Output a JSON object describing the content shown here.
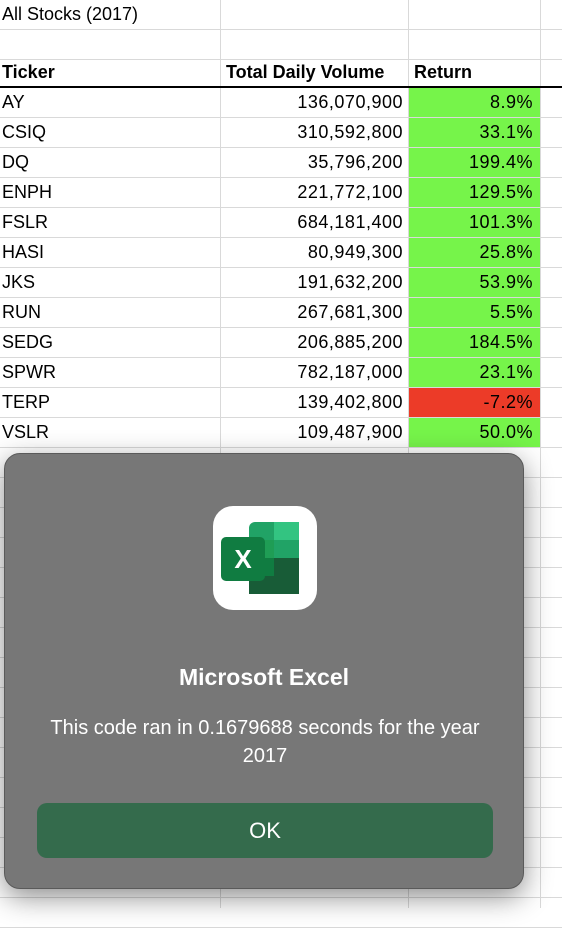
{
  "sheet": {
    "title": "All Stocks (2017)",
    "headers": [
      "Ticker",
      "Total Daily Volume",
      "Return"
    ],
    "rows": [
      {
        "ticker": "AY",
        "volume": "136,070,900",
        "ret": "8.9%",
        "status": "positive"
      },
      {
        "ticker": "CSIQ",
        "volume": "310,592,800",
        "ret": "33.1%",
        "status": "positive"
      },
      {
        "ticker": "DQ",
        "volume": "35,796,200",
        "ret": "199.4%",
        "status": "positive"
      },
      {
        "ticker": "ENPH",
        "volume": "221,772,100",
        "ret": "129.5%",
        "status": "positive"
      },
      {
        "ticker": "FSLR",
        "volume": "684,181,400",
        "ret": "101.3%",
        "status": "positive"
      },
      {
        "ticker": "HASI",
        "volume": "80,949,300",
        "ret": "25.8%",
        "status": "positive"
      },
      {
        "ticker": "JKS",
        "volume": "191,632,200",
        "ret": "53.9%",
        "status": "positive"
      },
      {
        "ticker": "RUN",
        "volume": "267,681,300",
        "ret": "5.5%",
        "status": "positive"
      },
      {
        "ticker": "SEDG",
        "volume": "206,885,200",
        "ret": "184.5%",
        "status": "positive"
      },
      {
        "ticker": "SPWR",
        "volume": "782,187,000",
        "ret": "23.1%",
        "status": "positive"
      },
      {
        "ticker": "TERP",
        "volume": "139,402,800",
        "ret": "-7.2%",
        "status": "negative"
      },
      {
        "ticker": "VSLR",
        "volume": "109,487,900",
        "ret": "50.0%",
        "status": "positive"
      }
    ]
  },
  "colors": {
    "positive": "#76f44a",
    "negative": "#ec3b28",
    "ok_button": "#346b4c"
  },
  "dialog": {
    "icon": "excel-app-icon",
    "icon_letter": "X",
    "title": "Microsoft Excel",
    "message": "This code ran in 0.1679688 seconds for the year 2017",
    "ok_label": "OK"
  }
}
